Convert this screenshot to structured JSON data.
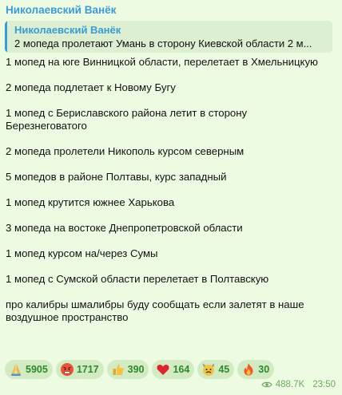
{
  "message": {
    "sender": "Николаевский Ванёк",
    "reply": {
      "name": "Николаевский Ванёк",
      "text": "2 мопеда пролетают Умань в сторону Киевской области  2 м..."
    },
    "paragraphs": [
      "1 мопед на юге Винницкой области, перелетает в Хмельницкую",
      "2 мопеда подлетает к Новому Бугу",
      "1 мопед с Бериславского района летит в сторону\nБерезнеговатого",
      "2 мопеда пролетели Никополь курсом северным",
      "5 мопедов в районе Полтавы, курс западный",
      "1 мопед крутится южнее Харькова",
      "3 мопеда на востоке Днепропетровской области",
      "1 мопед курсом на/через Сумы",
      "1 мопед с Сумской области перелетает в Полтавскую",
      "про калибры шмалибры буду сообщать если залетят в наше\nвоздушное пространство"
    ],
    "reactions": [
      {
        "icon": "praying-hands-icon",
        "count": "5905"
      },
      {
        "icon": "angry-face-icon",
        "count": "1717"
      },
      {
        "icon": "thumbs-up-icon",
        "count": "390"
      },
      {
        "icon": "red-heart-icon",
        "count": "164"
      },
      {
        "icon": "cursing-face-icon",
        "count": "45"
      },
      {
        "icon": "fire-icon",
        "count": "30"
      }
    ],
    "views": "488.7K",
    "time": "23:50"
  },
  "colors": {
    "accent": "#3a9bd5",
    "bubble": "#eefbe3",
    "reaction_bg": "#d3ebc3",
    "reaction_text": "#2e8a2d",
    "meta": "#6eaa5c"
  }
}
